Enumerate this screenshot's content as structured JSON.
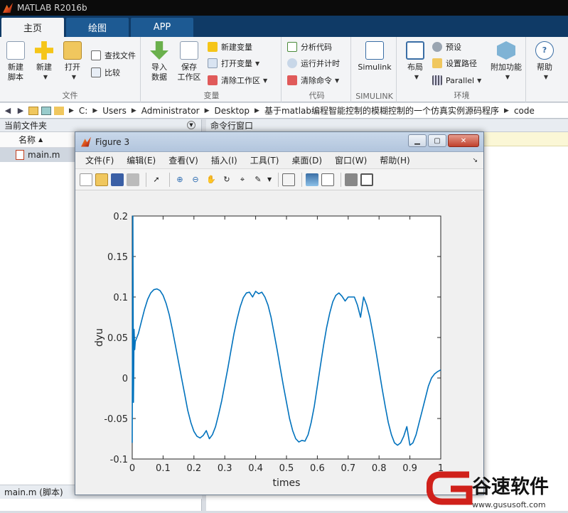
{
  "app": {
    "title": "MATLAB R2016b"
  },
  "tabs": [
    {
      "label": "主页",
      "active": true
    },
    {
      "label": "绘图",
      "active": false
    },
    {
      "label": "APP",
      "active": false
    }
  ],
  "ribbon": {
    "file_group": {
      "label": "文件",
      "new_script": "新建\n脚本",
      "new": "新建",
      "open": "打开",
      "find_files": "查找文件",
      "compare": "比较"
    },
    "variable_group": {
      "label": "变量",
      "import_data": "导入\n数据",
      "save_workspace": "保存\n工作区",
      "new_variable": "新建变量",
      "open_variable": "打开变量",
      "clear_workspace": "清除工作区"
    },
    "code_group": {
      "label": "代码",
      "analyze_code": "分析代码",
      "run_time": "运行并计时",
      "clear_commands": "清除命令"
    },
    "simulink_group": {
      "label": "SIMULINK",
      "simulink": "Simulink"
    },
    "env_group": {
      "label": "环境",
      "layout": "布局",
      "preferences": "预设",
      "set_path": "设置路径",
      "parallel": "Parallel",
      "addons": "附加功能"
    },
    "resources_group": {
      "help": "帮助"
    }
  },
  "address": {
    "crumbs": [
      "C:",
      "Users",
      "Administrator",
      "Desktop",
      "基于matlab编程智能控制的模糊控制的一个仿真实例源码程序",
      "code"
    ]
  },
  "current_folder": {
    "header": "当前文件夹",
    "column_name": "名称",
    "files": [
      "main.m"
    ],
    "status": "main.m  (脚本)"
  },
  "command_window": {
    "header": "命令行窗口"
  },
  "figure": {
    "title": "Figure 3",
    "menus": [
      "文件(F)",
      "编辑(E)",
      "查看(V)",
      "插入(I)",
      "工具(T)",
      "桌面(D)",
      "窗口(W)",
      "帮助(H)"
    ]
  },
  "chart_data": {
    "type": "line",
    "title": "",
    "xlabel": "times",
    "ylabel": "dyu",
    "xlim": [
      0,
      1
    ],
    "ylim": [
      -0.1,
      0.2
    ],
    "xticks": [
      "0",
      "0.1",
      "0.2",
      "0.3",
      "0.4",
      "0.5",
      "0.6",
      "0.7",
      "0.8",
      "0.9",
      "1"
    ],
    "yticks": [
      "-0.1",
      "-0.05",
      "0",
      "0.05",
      "0.1",
      "0.15",
      "0.2"
    ],
    "series": [
      {
        "color": "#0072BD",
        "x": [
          0,
          0.002,
          0.004,
          0.006,
          0.008,
          0.01,
          0.015,
          0.02,
          0.03,
          0.04,
          0.05,
          0.06,
          0.07,
          0.08,
          0.09,
          0.1,
          0.11,
          0.12,
          0.13,
          0.14,
          0.15,
          0.16,
          0.17,
          0.18,
          0.19,
          0.2,
          0.21,
          0.22,
          0.23,
          0.24,
          0.25,
          0.26,
          0.27,
          0.28,
          0.29,
          0.3,
          0.31,
          0.32,
          0.33,
          0.34,
          0.35,
          0.36,
          0.37,
          0.38,
          0.39,
          0.4,
          0.41,
          0.42,
          0.43,
          0.44,
          0.45,
          0.46,
          0.47,
          0.48,
          0.49,
          0.5,
          0.51,
          0.52,
          0.53,
          0.54,
          0.55,
          0.56,
          0.57,
          0.58,
          0.59,
          0.6,
          0.61,
          0.62,
          0.63,
          0.64,
          0.65,
          0.66,
          0.67,
          0.68,
          0.69,
          0.7,
          0.71,
          0.72,
          0.73,
          0.74,
          0.75,
          0.76,
          0.77,
          0.78,
          0.79,
          0.8,
          0.81,
          0.82,
          0.83,
          0.84,
          0.85,
          0.86,
          0.87,
          0.88,
          0.89,
          0.9,
          0.91,
          0.92,
          0.93,
          0.94,
          0.95,
          0.96,
          0.97,
          0.98,
          0.99,
          1.0
        ],
        "y": [
          -0.08,
          0.2,
          -0.03,
          0.06,
          0.035,
          0.045,
          0.05,
          0.055,
          0.07,
          0.085,
          0.097,
          0.105,
          0.109,
          0.11,
          0.108,
          0.102,
          0.092,
          0.078,
          0.06,
          0.04,
          0.02,
          0.0,
          -0.02,
          -0.04,
          -0.055,
          -0.066,
          -0.072,
          -0.074,
          -0.071,
          -0.065,
          -0.075,
          -0.07,
          -0.06,
          -0.045,
          -0.028,
          -0.008,
          0.012,
          0.034,
          0.055,
          0.073,
          0.088,
          0.099,
          0.105,
          0.106,
          0.1,
          0.107,
          0.104,
          0.106,
          0.1,
          0.09,
          0.075,
          0.055,
          0.034,
          0.012,
          -0.01,
          -0.03,
          -0.05,
          -0.065,
          -0.075,
          -0.079,
          -0.077,
          -0.078,
          -0.07,
          -0.055,
          -0.035,
          -0.01,
          0.015,
          0.04,
          0.062,
          0.08,
          0.094,
          0.102,
          0.105,
          0.101,
          0.095,
          0.1,
          0.1,
          0.1,
          0.09,
          0.075,
          0.1,
          0.09,
          0.075,
          0.055,
          0.033,
          0.01,
          -0.013,
          -0.035,
          -0.055,
          -0.07,
          -0.08,
          -0.083,
          -0.08,
          -0.072,
          -0.06,
          -0.083,
          -0.08,
          -0.07,
          -0.055,
          -0.04,
          -0.025,
          -0.01,
          0.0,
          0.005,
          0.008,
          0.01
        ]
      }
    ]
  },
  "watermark": {
    "brand": "谷速软件",
    "url": "www.gususoft.com"
  }
}
